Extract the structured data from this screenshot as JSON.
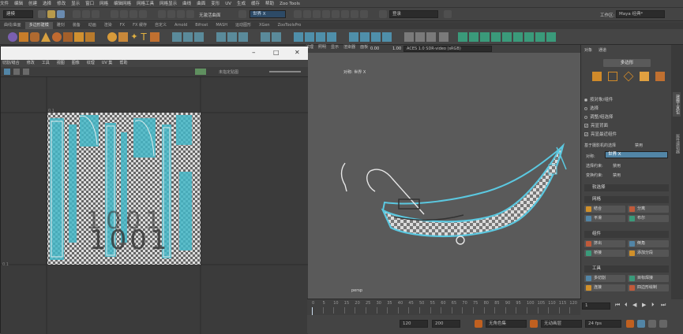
{
  "menubar": {
    "items": [
      "文件",
      "编辑",
      "创建",
      "选择",
      "修改",
      "显示",
      "窗口",
      "网格",
      "编辑网格",
      "网格工具",
      "网格显示",
      "曲线",
      "曲面",
      "变形",
      "UV",
      "生成",
      "缓存",
      "帮助",
      "Zoo Tools"
    ]
  },
  "status": {
    "mode": "建模",
    "live_surface": "无激活曲面",
    "symmetry": "世界 X",
    "login": "登录",
    "workspace_label": "工作区:",
    "workspace": "Maya 经典*"
  },
  "shelf": {
    "tabs": [
      "曲线/曲面",
      "多边形建模",
      "雕刻",
      "装备",
      "动画",
      "渲染",
      "FX",
      "FX 缓存",
      "自定义",
      "Arnold",
      "Bifrost",
      "MASH",
      "运动图形",
      "XGen",
      "ZooToolsPro"
    ],
    "active": 1
  },
  "uv_editor": {
    "menu": [
      "切割/缝合",
      "修改",
      "工具",
      "视图",
      "图像",
      "纹理",
      "UV 集",
      "帮助"
    ],
    "tex_label": "未指定贴图",
    "tile_text": [
      "1001",
      "1001"
    ],
    "axis_labels": [
      "0.1",
      "0.1"
    ]
  },
  "viewport": {
    "menu": [
      "纹理",
      "照明",
      "显示",
      "渲染器",
      "面板"
    ],
    "exposure": "0.00",
    "gamma": "1.00",
    "colorspace": "ACES 1.0 SDR-video (sRGB)",
    "symmetry_label": "对称: 世界 X",
    "camera": "persp"
  },
  "attr": {
    "tabs": [
      "对象",
      "通道"
    ],
    "title": "多边形",
    "sel_items": [
      "按对象/组件",
      "选择",
      "调整/组选择",
      "亮显背面",
      "亮显最近组件"
    ],
    "sel_checked": [
      false,
      false,
      false,
      true,
      true
    ],
    "symmetry_header": "基于摄影机的选择",
    "symmetry_toggle": "禁用",
    "symmetry_label": "对称:",
    "symmetry_value": "世界 X",
    "select_constraint": "选择约束:",
    "select_constraint_value": "禁用",
    "transform_constraint": "变换约束:",
    "transform_constraint_value": "禁用",
    "soft_select": "软选择",
    "sections": [
      {
        "title": "网格",
        "buttons": [
          "结合",
          "分离",
          "平滑",
          "布尔"
        ]
      },
      {
        "title": "组件",
        "buttons": [
          "挤出",
          "倒角",
          "桥接",
          "添加分段"
        ]
      },
      {
        "title": "工具",
        "buttons": [
          "多切割",
          "目标焊接",
          "连接",
          "四边形绘制"
        ]
      }
    ]
  },
  "side_tabs": [
    "建模工具包",
    "属性编辑器"
  ],
  "timeline": {
    "ticks": [
      "0",
      "5",
      "10",
      "15",
      "20",
      "25",
      "30",
      "35",
      "40",
      "45",
      "50",
      "55",
      "60",
      "65",
      "70",
      "75",
      "80",
      "85",
      "90",
      "95",
      "100",
      "105",
      "110",
      "115",
      "120"
    ],
    "current_frame": "1"
  },
  "range": {
    "start": "120",
    "end": "200",
    "char_set": "无角色集",
    "anim_layer": "无动画层",
    "fps": "24 fps"
  },
  "colors": {
    "accent": "#5285a6",
    "mesh_cyan": "#5bc8e0",
    "bg": "#444444"
  }
}
